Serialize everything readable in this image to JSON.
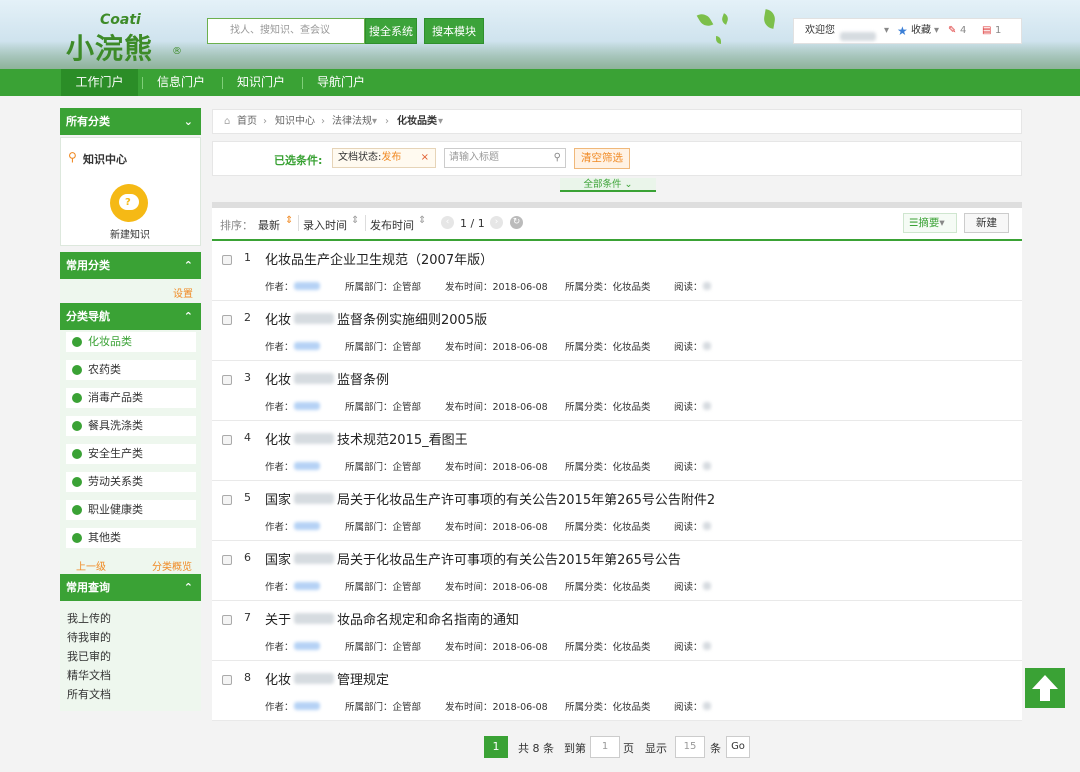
{
  "header": {
    "logo_en": "Coati",
    "logo_cn": "小浣熊",
    "logo_mark": "®",
    "search_placeholder": "找人、搜知识、查会议",
    "search_all_label": "搜全系统",
    "search_module_label": "搜本模块",
    "welcome": "欢迎您",
    "favorites": "收藏",
    "edit_count": "4",
    "doc_count": "1"
  },
  "nav": {
    "items": [
      {
        "label": "工作门户"
      },
      {
        "label": "信息门户"
      },
      {
        "label": "知识门户"
      },
      {
        "label": "导航门户"
      }
    ]
  },
  "sidebar": {
    "all_categories": "所有分类",
    "knowledge_center": "知识中心",
    "new_knowledge": "新建知识",
    "common_categories": "常用分类",
    "settings": "设置",
    "category_nav": "分类导航",
    "categories": [
      {
        "label": "化妆品类"
      },
      {
        "label": "农药类"
      },
      {
        "label": "消毒产品类"
      },
      {
        "label": "餐具洗涤类"
      },
      {
        "label": "安全生产类"
      },
      {
        "label": "劳动关系类"
      },
      {
        "label": "职业健康类"
      },
      {
        "label": "其他类"
      }
    ],
    "prev_level": "上一级",
    "category_overview": "分类概览",
    "common_queries": "常用查询",
    "queries": [
      {
        "label": "我上传的"
      },
      {
        "label": "待我审的"
      },
      {
        "label": "我已审的"
      },
      {
        "label": "精华文档"
      },
      {
        "label": "所有文档"
      }
    ]
  },
  "breadcrumb": {
    "home": "首页",
    "level1": "知识中心",
    "level2": "法律法规",
    "current": "化妆品类"
  },
  "filter": {
    "selected_label": "已选条件:",
    "tag_label": "文档状态:",
    "tag_value": "发布",
    "title_placeholder": "请输入标题",
    "clear_label": "清空筛选",
    "all_conditions": "全部条件"
  },
  "toolbar": {
    "sort_label": "排序：",
    "sort_newest": "最新",
    "sort_entry_time": "录入时间",
    "sort_publish_time": "发布时间",
    "page_info": "1 / 1",
    "summary_label": "摘要",
    "new_label": "新建"
  },
  "list": {
    "author_label": "作者：",
    "dept_label": "所属部门：企管部",
    "time_label": "发布时间：2018-06-08",
    "category_label": "所属分类：化妆品类",
    "read_label": "阅读：",
    "rows": [
      {
        "num": "1",
        "title_a": "化妆品生产企业卫生规范（2007年版）",
        "title_b": ""
      },
      {
        "num": "2",
        "title_a": "化妆",
        "title_b": "监督条例实施细则2005版"
      },
      {
        "num": "3",
        "title_a": "化妆",
        "title_b": "监督条例"
      },
      {
        "num": "4",
        "title_a": "化妆",
        "title_b": "技术规范2015_看图王"
      },
      {
        "num": "5",
        "title_a": "国家",
        "title_b": "局关于化妆品生产许可事项的有关公告2015年第265号公告附件2"
      },
      {
        "num": "6",
        "title_a": "国家",
        "title_b": "局关于化妆品生产许可事项的有关公告2015年第265号公告"
      },
      {
        "num": "7",
        "title_a": "关于",
        "title_b": "妆品命名规定和命名指南的通知"
      },
      {
        "num": "8",
        "title_a": "化妆",
        "title_b": "管理规定"
      }
    ]
  },
  "pagination": {
    "current": "1",
    "total": "共 8 条",
    "goto_label": "到第",
    "goto_value": "1",
    "page_unit": "页",
    "show_label": "显示",
    "show_value": "15",
    "item_unit": "条",
    "go": "Go"
  },
  "colors": {
    "brand_green": "#3aa235",
    "accent_orange": "#f08a24"
  }
}
